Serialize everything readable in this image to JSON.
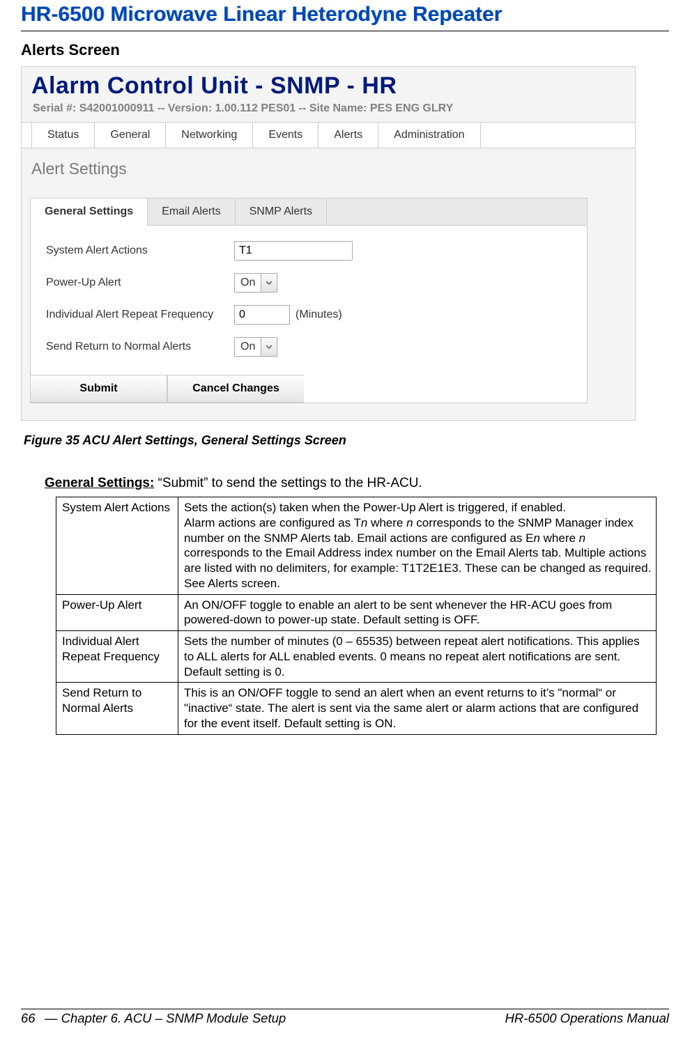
{
  "doc_title": "HR-6500 Microwave Linear Heterodyne Repeater",
  "section_heading": "Alerts Screen",
  "screenshot": {
    "header_title": "Alarm Control Unit - SNMP - HR",
    "subline": "Serial #: S42001000911   --   Version: 1.00.112 PES01   --   Site Name:  PES ENG GLRY",
    "main_tabs": [
      "Status",
      "General",
      "Networking",
      "Events",
      "Alerts",
      "Administration"
    ],
    "panel_title": "Alert Settings",
    "sub_tabs": [
      "General Settings",
      "Email Alerts",
      "SNMP Alerts"
    ],
    "form": {
      "system_alert_actions_label": "System Alert Actions",
      "system_alert_actions_value": "T1",
      "power_up_alert_label": "Power-Up Alert",
      "power_up_alert_value": "On",
      "repeat_freq_label": "Individual Alert Repeat Frequency",
      "repeat_freq_value": "0",
      "repeat_freq_unit": "(Minutes)",
      "send_return_label": "Send Return to Normal Alerts",
      "send_return_value": "On",
      "submit_label": "Submit",
      "cancel_label": "Cancel Changes"
    }
  },
  "figure_caption": "Figure 35  ACU Alert Settings, General Settings Screen",
  "general_settings_line_label": "General Settings:",
  "general_settings_line_text": " “Submit” to send the settings to the HR-ACU.",
  "table": {
    "rows": [
      {
        "label": "System Alert Actions",
        "html": "Sets the action(s) taken when the Power-Up Alert is triggered, if enabled.\nAlarm actions are configured as T<em>n</em> where <em>n</em> corresponds to the SNMP Manager index number on the SNMP Alerts tab. Email actions are configured as E<em>n</em> where <em>n</em> corresponds to the Email Address index number on the Email Alerts tab. Multiple actions are listed with no delimiters, for example: T1T2E1E3. These can be changed as required. See Alerts screen."
      },
      {
        "label": "Power-Up Alert",
        "html": "An ON/OFF toggle to enable an alert to be sent whenever the HR-ACU goes from powered-down to power-up state. Default setting is OFF."
      },
      {
        "label": "Individual Alert Repeat Frequency",
        "html": "Sets the number of minutes (0 – 65535) between repeat alert notifications. This applies to ALL alerts for ALL enabled events. 0 means no repeat alert notifications are sent. Default setting is 0."
      },
      {
        "label": "Send Return to Normal Alerts",
        "html": "This is an ON/OFF toggle to send an alert when an event returns to it’s \"normal“ or \"inactive“ state. The alert is sent via the same alert or alarm actions that are configured for the event itself. Default setting is ON."
      }
    ]
  },
  "footer": {
    "page_no": "66",
    "chapter": " — Chapter 6. ACU – SNMP Module Setup",
    "manual": "HR-6500 Operations Manual"
  }
}
